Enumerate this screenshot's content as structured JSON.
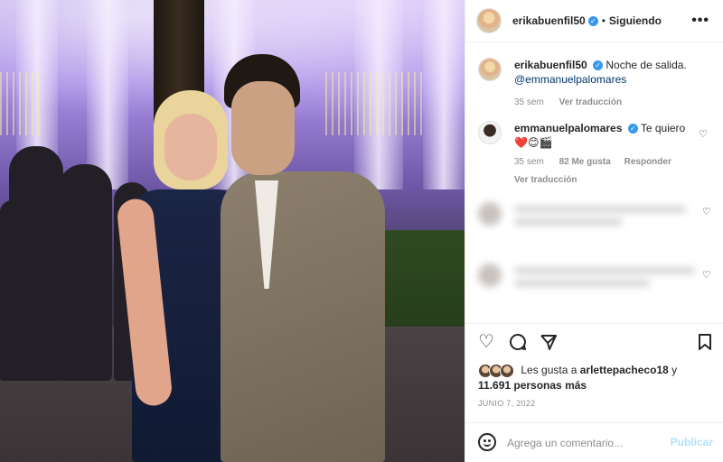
{
  "post": {
    "author": {
      "username": "erikabuenfil50",
      "verified_icon": "verified-badge-icon",
      "follow_status": "Siguiendo",
      "separator": "•"
    },
    "menu_icon": "more-options-icon",
    "caption": {
      "username": "erikabuenfil50",
      "text": "Noche de salida.",
      "mention": "@emmanuelpalomares",
      "age": "35 sem",
      "translate": "Ver traducción"
    },
    "comments": [
      {
        "username": "emmanuelpalomares",
        "verified_icon": "verified-badge-icon",
        "text": "Te quiero",
        "emojis": "❤️😊🎬",
        "age": "35 sem",
        "likes": "82 Me gusta",
        "reply": "Responder",
        "translate": "Ver traducción",
        "like_icon": "heart-outline-icon"
      }
    ],
    "blurred_comments": [
      {
        "like_icon": "heart-outline-icon"
      },
      {
        "like_icon": "heart-outline-icon"
      }
    ],
    "actions": {
      "like_icon": "heart-outline-icon",
      "comment_icon": "comment-bubble-icon",
      "share_icon": "paper-plane-icon",
      "save_icon": "bookmark-outline-icon"
    },
    "likes": {
      "prefix": "Les gusta a",
      "user": "arlettepacheco18",
      "connector": "y",
      "count_text": "11.691 personas más"
    },
    "date": "JUNIO 7, 2022",
    "add_comment": {
      "emoji_icon": "emoji-smile-icon",
      "placeholder": "Agrega un comentario...",
      "publish_label": "Publicar"
    }
  },
  "colors": {
    "link_blue": "#00376b",
    "verified_blue": "#3897f0",
    "publish_disabled": "#b2dffc",
    "meta_gray": "#8e8e8e",
    "text": "#262626"
  }
}
